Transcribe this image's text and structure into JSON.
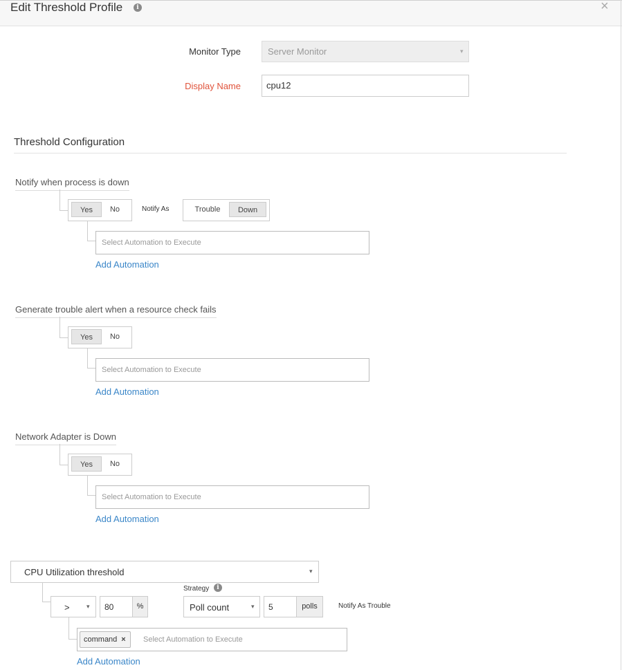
{
  "header": {
    "title": "Edit Threshold Profile",
    "close_glyph": "×"
  },
  "form": {
    "monitor_type_label": "Monitor Type",
    "monitor_type_value": "Server Monitor",
    "display_name_label": "Display Name",
    "display_name_value": "cpu12"
  },
  "threshold": {
    "section_title": "Threshold Configuration",
    "automation_placeholder": "Select Automation to Execute",
    "add_automation_label": "Add Automation",
    "rules": [
      {
        "label": "Notify when process is down",
        "yes": "Yes",
        "no": "No",
        "notify_as_label": "Notify As",
        "notify_trouble": "Trouble",
        "notify_down": "Down"
      },
      {
        "label": "Generate trouble alert when a resource check fails",
        "yes": "Yes",
        "no": "No"
      },
      {
        "label": "Network Adapter is Down",
        "yes": "Yes",
        "no": "No"
      }
    ],
    "cpu": {
      "metric": "CPU Utilization threshold",
      "operator": ">",
      "value": "80",
      "unit": "%",
      "strategy_label": "Strategy",
      "strategy_value": "Poll count",
      "polls_value": "5",
      "polls_unit": "polls",
      "notify_as": "Notify As Trouble",
      "tag": "command",
      "tag_remove": "×"
    }
  },
  "icons": {
    "info": "info-icon",
    "caret": "▾"
  },
  "colors": {
    "required_label": "#e0533b",
    "link": "#3a86c8"
  }
}
